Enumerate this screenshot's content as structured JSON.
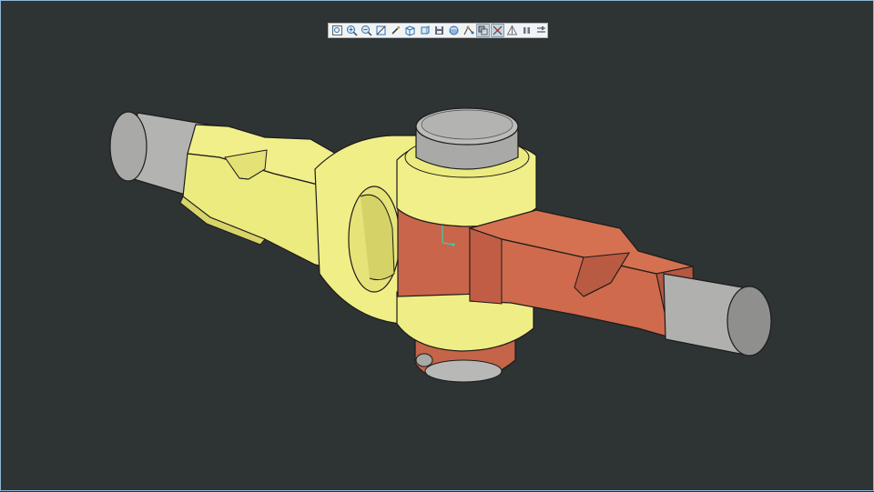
{
  "window": {
    "background": "#2e3334",
    "border_color": "#8fb6d8"
  },
  "toolbar": {
    "buttons": [
      {
        "name": "zoom-fit-icon",
        "active": false
      },
      {
        "name": "zoom-in-icon",
        "active": false
      },
      {
        "name": "zoom-out-icon",
        "active": false
      },
      {
        "name": "zoom-window-icon",
        "active": false
      },
      {
        "name": "pan-icon",
        "active": false
      },
      {
        "name": "view-cube-icon",
        "active": false
      },
      {
        "name": "view-orientation-icon",
        "active": false
      },
      {
        "name": "save-image-icon",
        "active": false
      },
      {
        "name": "render-style-icon",
        "active": false
      },
      {
        "name": "sketch-icon",
        "active": false
      },
      {
        "name": "transparency-icon",
        "active": true
      },
      {
        "name": "section-cut-icon",
        "active": true
      },
      {
        "name": "wireframe-icon",
        "active": false
      },
      {
        "name": "pause-icon",
        "active": false
      },
      {
        "name": "settings-icon",
        "active": false
      }
    ]
  },
  "model": {
    "part_colors": {
      "yoke_yellow": "#eded80",
      "yoke_yellow_shade": "#d9d66a",
      "yoke_red": "#c8644a",
      "yoke_red_light": "#d8714f",
      "shaft_gray": "#b0b0ae",
      "shaft_gray_dark": "#8c8c8a"
    },
    "axis_indicator_color": "#2fd3b0"
  }
}
